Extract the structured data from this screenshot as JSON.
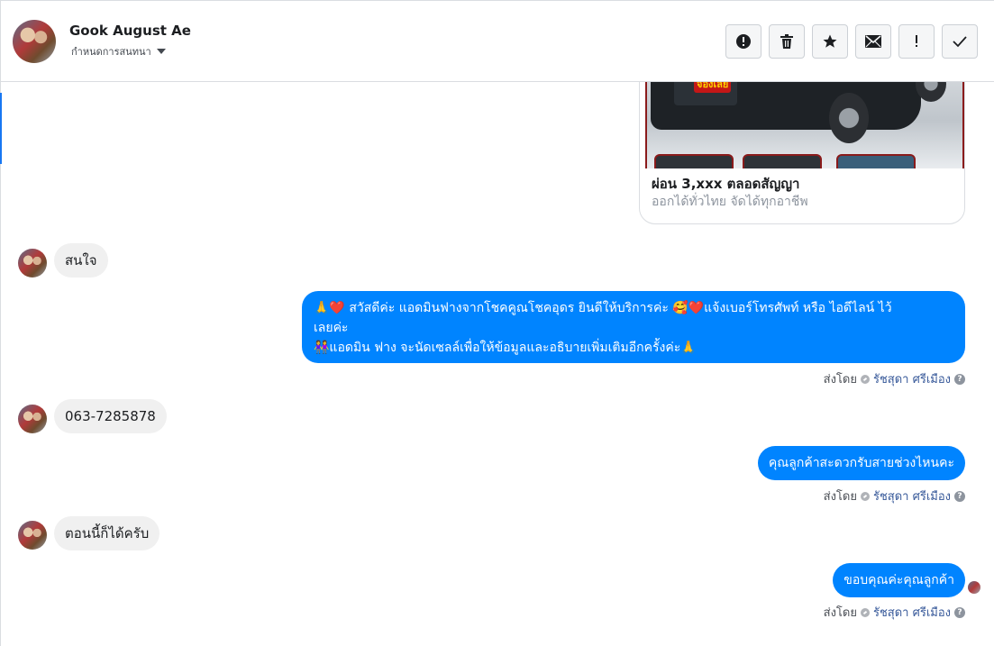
{
  "header": {
    "contact_name": "Gook August Ae",
    "subtitle": "กำหนดการสนทนา",
    "tools": [
      {
        "name": "report-button",
        "icon": "alert-circle-icon"
      },
      {
        "name": "delete-button",
        "icon": "trash-icon"
      },
      {
        "name": "star-button",
        "icon": "star-icon"
      },
      {
        "name": "mark-unread-button",
        "icon": "envelope-icon"
      },
      {
        "name": "important-button",
        "icon": "exclamation-icon"
      },
      {
        "name": "done-button",
        "icon": "check-icon"
      }
    ]
  },
  "card": {
    "stamp": "จองเลย",
    "title": "ผ่อน 3,xxx ตลอดสัญญา",
    "subtitle": "ออกได้ทั่วไทย จัดได้ทุกอาชีพ"
  },
  "messages": {
    "in1": "สนใจ",
    "out1": {
      "line1": "🙏❤️ สวัสดีค่ะ แอดมินฟางจากโชคคูณโชคอุดร ยินดีให้บริการค่ะ 🥰❤️แจ้งเบอร์โทรศัพท์ หรือ ไอดีไลน์ ไว้",
      "line2": "เลยค่ะ",
      "line3": "👭แอดมิน ฟาง จะนัดเซลล์เพื่อให้ข้อมูลและอธิบายเพิ่มเติมอีกครั้งค่ะ🙏"
    },
    "in2": "063-7285878",
    "out2": "คุณลูกค้าสะดวกรับสายช่วงไหนคะ",
    "in3": "ตอนนี้ก็ได้ครับ",
    "out3": "ขอบคุณค่ะคุณลูกค้า"
  },
  "sent_by": {
    "prefix": "ส่งโดย",
    "agent": "รัชสุดา ศรีเมือง",
    "help": "?"
  },
  "colors": {
    "outgoing_bubble": "#0084ff",
    "incoming_bubble": "#f0f0f0",
    "agent_link": "#365899"
  }
}
